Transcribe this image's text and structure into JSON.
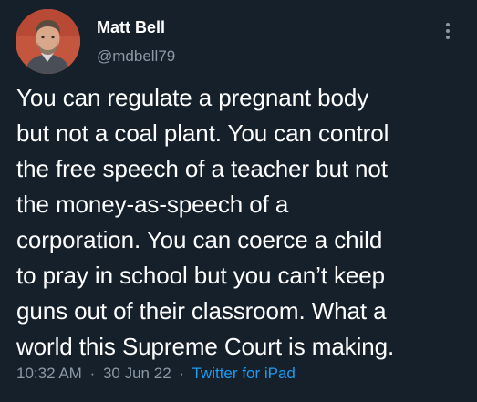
{
  "author": {
    "name": "Matt Bell",
    "handle": "@mdbell79"
  },
  "tweet": {
    "lines": [
      "You can regulate a pregnant body",
      "but not a coal plant. You can control",
      "the free speech of a teacher but not",
      "the money-as-speech of a",
      "corporation. You can coerce a child",
      "to pray in school but you can’t keep",
      "guns out of their classroom. What a",
      "world this Supreme Court is making."
    ]
  },
  "meta": {
    "time": "10:32 AM",
    "separator": "·",
    "date": "30 Jun 22",
    "source": "Twitter for iPad"
  },
  "icons": {
    "more": "more-vertical-icon"
  },
  "colors": {
    "background": "#15202b",
    "text": "#ffffff",
    "secondary": "#8b98a5",
    "accent": "#1d9bf0"
  }
}
